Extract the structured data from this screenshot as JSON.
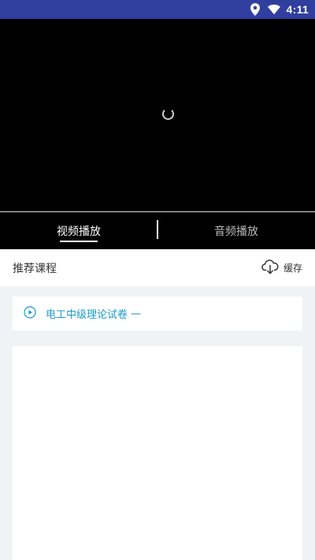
{
  "status_bar": {
    "time": "4:11",
    "icons": [
      "location-icon",
      "wifi-icon"
    ]
  },
  "player": {
    "state_icon": "loading-spinner"
  },
  "tabs": [
    {
      "label": "视频播放",
      "active": true
    },
    {
      "label": "音频播放",
      "active": false
    }
  ],
  "section": {
    "title": "推荐课程",
    "cache_label": "缓存",
    "cache_icon": "cloud-download-icon"
  },
  "course": {
    "icon": "play-circle-icon",
    "title": "电工中级理论试卷 一"
  },
  "colors": {
    "status_bar": "#303f9f",
    "accent": "#1a9bc6",
    "background": "#f0f2f5"
  }
}
